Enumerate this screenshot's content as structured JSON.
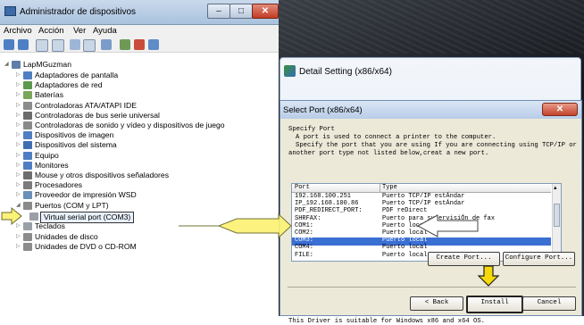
{
  "device_manager": {
    "title": "Administrador de dispositivos",
    "menu": [
      "Archivo",
      "Acción",
      "Ver",
      "Ayuda"
    ],
    "toolbar_icons": [
      "back-icon",
      "forward-icon",
      "view-icon",
      "properties-icon",
      "help-icon",
      "refresh-icon",
      "update-driver-icon",
      "disable-icon",
      "uninstall-icon",
      "scan-icon"
    ],
    "window_buttons": {
      "minimize": "‒",
      "maximize": "□",
      "close": "✕"
    },
    "tree": {
      "root": "LapMGuzman",
      "items": [
        "Adaptadores de pantalla",
        "Adaptadores de red",
        "Baterías",
        "Controladoras ATA/ATAPI IDE",
        "Controladoras de bus serie universal",
        "Controladoras de sonido y vídeo y dispositivos de juego",
        "Dispositivos de imagen",
        "Dispositivos del sistema",
        "Equipo",
        "Monitores",
        "Mouse y otros dispositivos señaladores",
        "Procesadores",
        "Proveedor de impresión WSD",
        "Puertos (COM y LPT)",
        "Teclados",
        "Unidades de disco",
        "Unidades de DVD o CD-ROM"
      ],
      "expanded_child": "Virtual serial port (COM3)"
    }
  },
  "detail_setting": {
    "title": "Detail Setting (x86/x64)"
  },
  "select_port": {
    "title": "Select Port (x86/x64)",
    "close": "✕",
    "heading": "Specify Port",
    "desc1": "A port is used to connect a printer to the computer.",
    "desc2": "Specify the port that you are using If you are connecting using TCP/IP or",
    "desc3": "another port type not listed below,creat a new port.",
    "columns": [
      "Port",
      "Type"
    ],
    "rows": [
      {
        "port": "192.168.100.251",
        "type": "Puerto TCP/IP estÁndar"
      },
      {
        "port": "IP_192.168.100.86",
        "type": "Puerto TCP/IP estÁndar"
      },
      {
        "port": "PDF_REDIRECT_PORT:",
        "type": "PDF reDirect"
      },
      {
        "port": "SHRFAX:",
        "type": "Puerto para supervisiÓn de fax"
      },
      {
        "port": "COM1:",
        "type": "Puerto local"
      },
      {
        "port": "COM2:",
        "type": "Puerto local"
      },
      {
        "port": "COM3:",
        "type": "Puerto local"
      },
      {
        "port": "COM4:",
        "type": "Puerto local"
      },
      {
        "port": "FILE:",
        "type": "Puerto local"
      }
    ],
    "selected_row": 6,
    "create_port": "Create Port...",
    "configure_port": "Configure Port...",
    "back": "< Back",
    "install": "Install",
    "cancel": "Cancel",
    "footer": "This Driver is suitable for Windows x86 and x64 OS."
  },
  "colors": {
    "selection": "#3a6fd3",
    "arrow_fill": "#fbf27a",
    "arrow_stroke": "#6b6b2a"
  }
}
